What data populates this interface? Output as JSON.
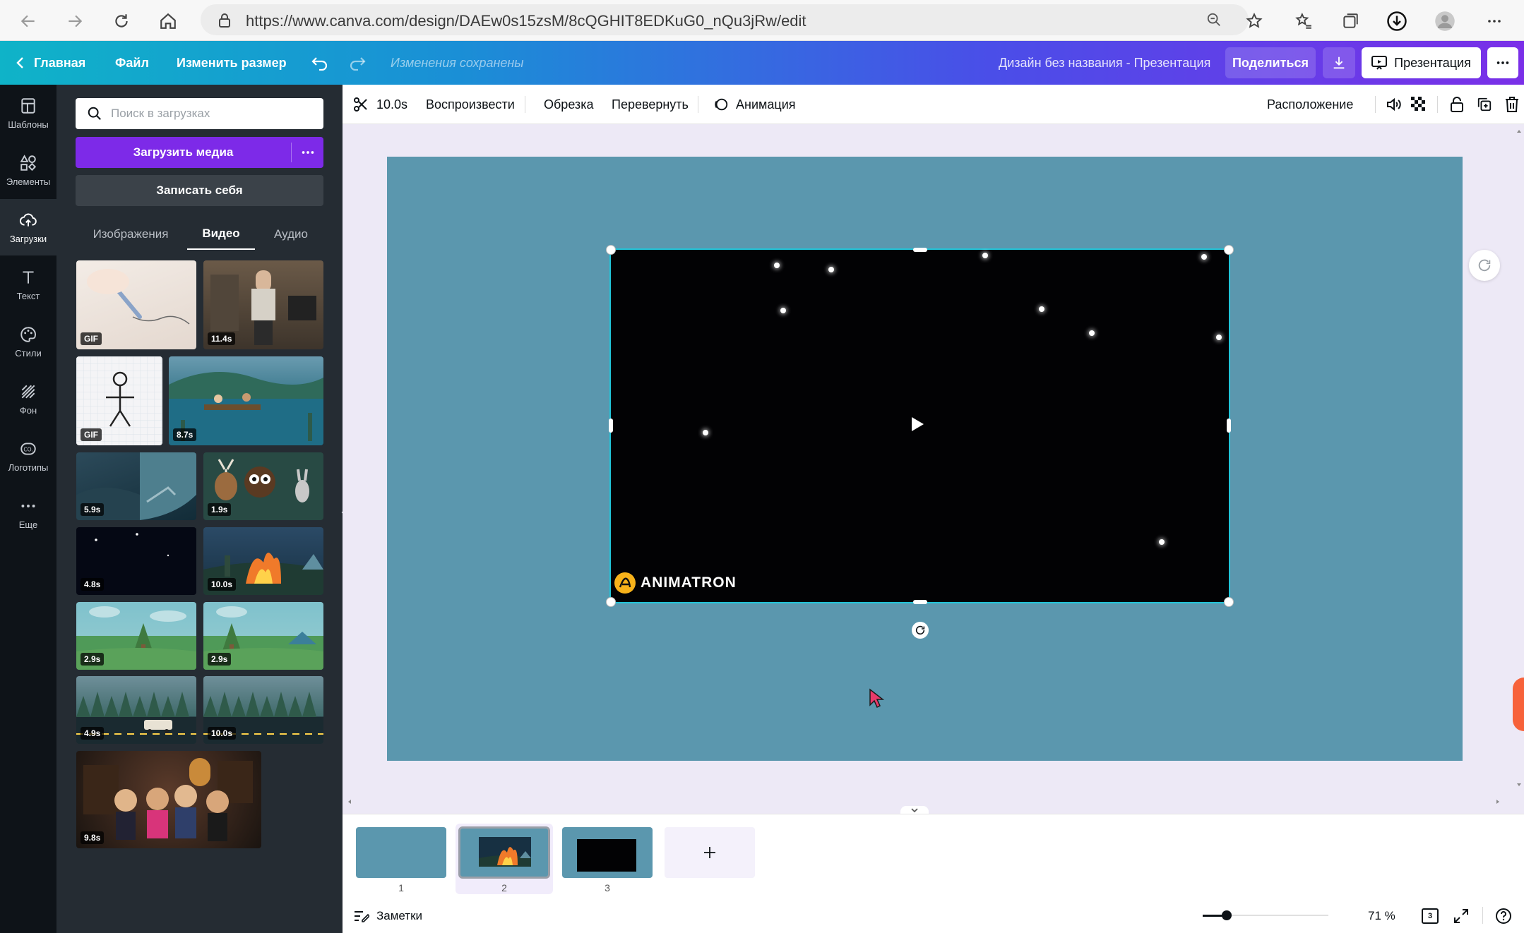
{
  "browser": {
    "url": "https://www.canva.com/design/DAEw0s15zsM/8cQGHIT8EDKuG0_nQu3jRw/edit"
  },
  "topbar": {
    "home": "Главная",
    "file": "Файл",
    "resize": "Изменить размер",
    "saved_status": "Изменения сохранены",
    "design_title": "Дизайн без названия - Презентация",
    "share": "Поделиться",
    "present": "Презентация"
  },
  "rail": {
    "items": [
      {
        "label": "Шаблоны",
        "icon": "templates-icon"
      },
      {
        "label": "Элементы",
        "icon": "elements-icon"
      },
      {
        "label": "Загрузки",
        "icon": "uploads-icon"
      },
      {
        "label": "Текст",
        "icon": "text-icon"
      },
      {
        "label": "Стили",
        "icon": "styles-icon"
      },
      {
        "label": "Фон",
        "icon": "background-icon"
      },
      {
        "label": "Логотипы",
        "icon": "logos-icon"
      },
      {
        "label": "Еще",
        "icon": "more-icon"
      }
    ]
  },
  "panel": {
    "search_placeholder": "Поиск в загрузках",
    "upload_label": "Загрузить медиа",
    "record_label": "Записать себя",
    "tabs": [
      "Изображения",
      "Видео",
      "Аудио"
    ],
    "active_tab": "Видео",
    "thumbs": [
      "GIF",
      "11.4s",
      "GIF",
      "8.7s",
      "5.9s",
      "1.9s",
      "4.8s",
      "10.0s",
      "2.9s",
      "2.9s",
      "4.9s",
      "10.0s",
      "9.8s"
    ]
  },
  "toolbar": {
    "duration": "10.0s",
    "play": "Воспроизвести",
    "trim": "Обрезка",
    "flip": "Перевернуть",
    "animation": "Анимация",
    "position": "Расположение"
  },
  "canvas": {
    "watermark": "ANIMATRON",
    "page_color": "#5b97ae"
  },
  "slides": {
    "numbers": [
      "1",
      "2",
      "3"
    ],
    "active": "2"
  },
  "footer": {
    "notes": "Заметки",
    "zoom": "71 %",
    "page_count": "3",
    "zoom_level": 0.1
  },
  "colors": {
    "accent": "#7d2ae8",
    "panel": "#252c33",
    "rail": "#0e1318",
    "selection": "#22c4d8"
  }
}
